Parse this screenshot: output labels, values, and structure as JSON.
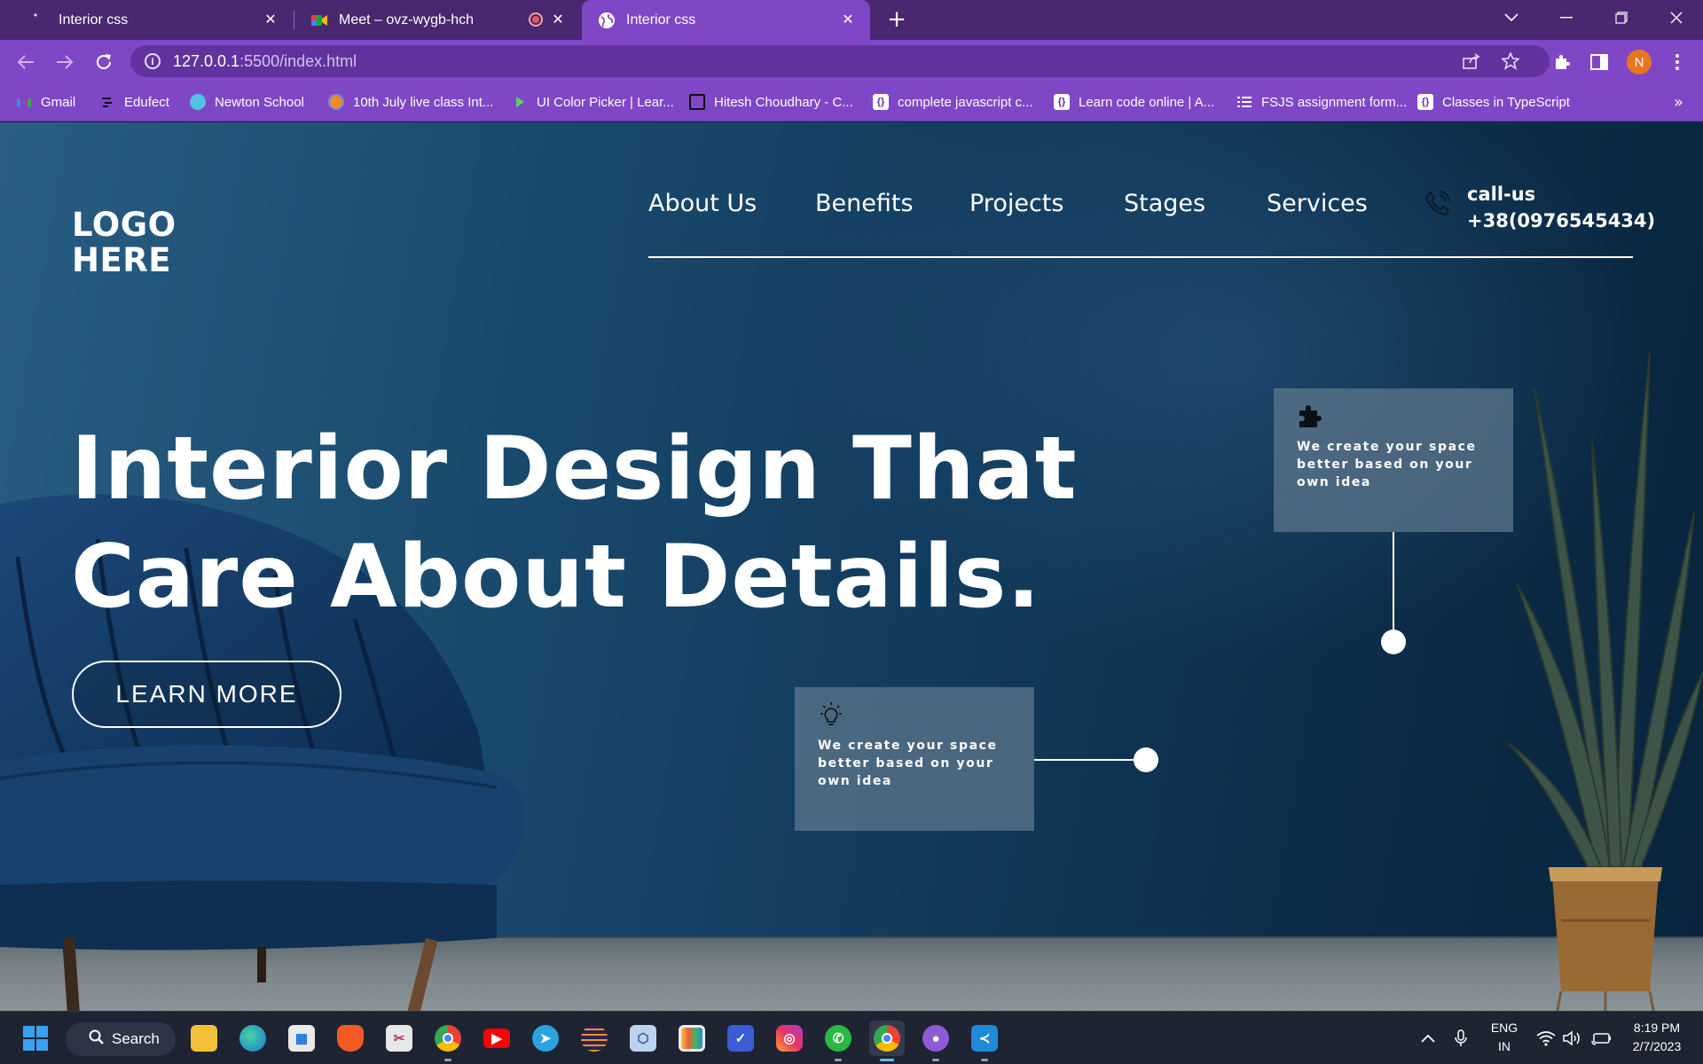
{
  "browser": {
    "tabs": [
      {
        "title": "Interior css",
        "active": false
      },
      {
        "title": "Meet – ovz-wygb-hch",
        "active": false
      },
      {
        "title": "Interior css",
        "active": true
      }
    ],
    "url_host": "127.0.0.1",
    "url_rest": ":5500/index.html",
    "profile_initial": "N",
    "bookmarks": [
      {
        "label": "Gmail",
        "icon": "gmail-icon"
      },
      {
        "label": "Edufect",
        "icon": "edufect-icon"
      },
      {
        "label": "Newton School",
        "icon": "newton-school-icon"
      },
      {
        "label": "10th July live class Int...",
        "icon": "class-icon"
      },
      {
        "label": "UI Color Picker | Lear...",
        "icon": "color-picker-icon"
      },
      {
        "label": "Hitesh Choudhary - C...",
        "icon": "square-icon"
      },
      {
        "label": "complete javascript c...",
        "icon": "code-icon"
      },
      {
        "label": "Learn code online | A...",
        "icon": "code-icon"
      },
      {
        "label": "FSJS assignment form...",
        "icon": "list-icon"
      },
      {
        "label": "Classes in TypeScript",
        "icon": "code-icon"
      }
    ],
    "bookmarks_more": "»"
  },
  "site": {
    "logo_line1": "LOGO",
    "logo_line2": "HERE",
    "nav": [
      "About Us",
      "Benefits",
      "Projects",
      "Stages",
      "Services"
    ],
    "call_label": "call-us",
    "call_number": "+38(0976545434)",
    "hero_line1": "Interior Design That",
    "hero_line2": "Care About Details.",
    "cta": "LEARN MORE",
    "card_top": {
      "icon": "puzzle-icon",
      "text": "We create your space better based on your own idea"
    },
    "card_bottom": {
      "icon": "lightbulb-icon",
      "text": "We create your space better based on your own idea"
    }
  },
  "taskbar": {
    "search_label": "Search",
    "lang_line1": "ENG",
    "lang_line2": "IN",
    "time": "8:19 PM",
    "date": "2/7/2023",
    "apps": [
      "windows-start-icon",
      "file-explorer-icon",
      "edge-icon",
      "store-icon",
      "brave-icon",
      "snipping-tool-icon",
      "chrome-icon",
      "youtube-icon",
      "telegram-icon",
      "eclipse-icon",
      "virtualbox-icon",
      "media-icon",
      "tasks-icon",
      "instagram-icon",
      "whatsapp-icon",
      "chrome-profile-icon",
      "github-desktop-icon",
      "vscode-icon"
    ]
  },
  "colors": {
    "tab_strip": "#4a2870",
    "toolbar": "#7f47c6",
    "page_bg": "#123b5c",
    "card_bg": "#60788e",
    "taskbar": "#1f2433"
  }
}
